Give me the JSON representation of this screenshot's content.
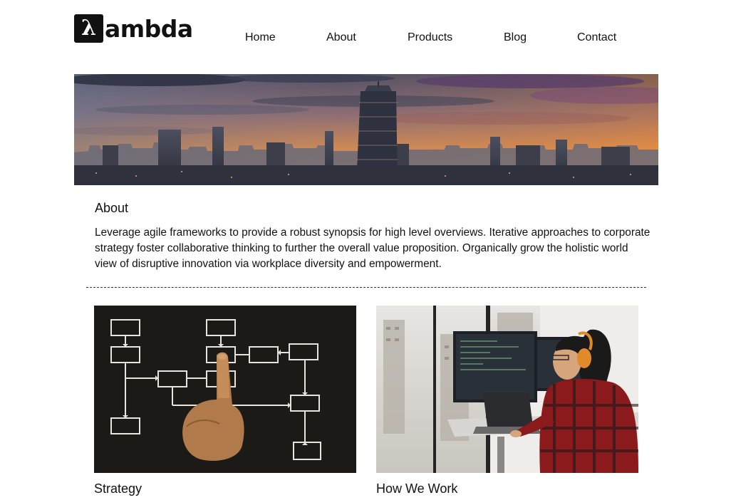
{
  "brand": {
    "logo_letter": "λ",
    "logo_text": "ambda"
  },
  "nav": {
    "items": [
      {
        "label": "Home"
      },
      {
        "label": "About"
      },
      {
        "label": "Products"
      },
      {
        "label": "Blog"
      },
      {
        "label": "Contact"
      }
    ]
  },
  "hero": {
    "icon": "city-skyline-sunset-photo"
  },
  "about": {
    "heading": "About",
    "body": "Leverage agile frameworks to provide a robust synopsis for high level overviews. Iterative approaches to corporate strategy foster collaborative thinking to further the overall value proposition. Organically grow the holistic world view of disruptive innovation via workplace diversity and empowerment."
  },
  "cards": [
    {
      "title": "Strategy",
      "icon": "chalkboard-flowchart-photo"
    },
    {
      "title": "How We Work",
      "icon": "developer-at-desk-photo"
    }
  ],
  "colors": {
    "text": "#111111",
    "background": "#ffffff",
    "divider": "#333333",
    "sky_orange": "#e8873a",
    "sky_purple": "#6b4a7a"
  }
}
